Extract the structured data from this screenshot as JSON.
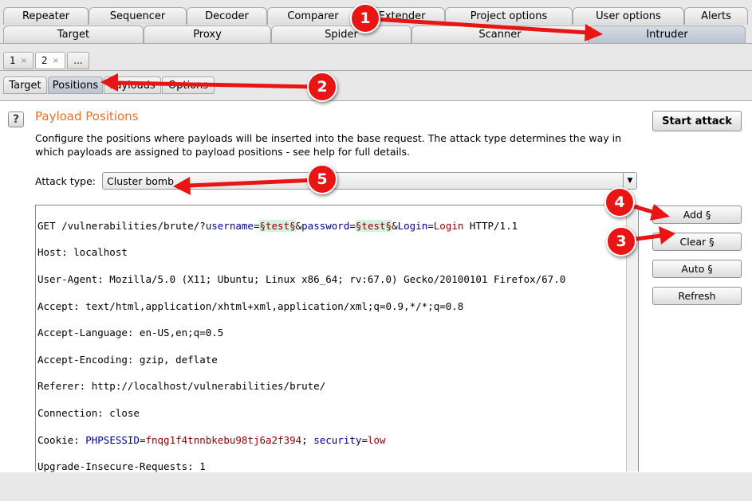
{
  "top_tabs_row1": [
    "Repeater",
    "Sequencer",
    "Decoder",
    "Comparer",
    "Extender",
    "Project options",
    "User options",
    "Alerts"
  ],
  "top_tabs_row2": [
    "Target",
    "Proxy",
    "Spider",
    "Scanner",
    "Intruder"
  ],
  "selected_top_tab": "Intruder",
  "sub_tabs": [
    {
      "label": "1",
      "close": "×"
    },
    {
      "label": "2",
      "close": "×"
    }
  ],
  "sub_tab_more": "...",
  "inner_tabs": [
    "Target",
    "Positions",
    "Payloads",
    "Options"
  ],
  "panel": {
    "help_icon": "?",
    "title": "Payload Positions",
    "description": "Configure the positions where payloads will be inserted into the base request. The attack type determines the way in which payloads are assigned to payload positions - see help for full details.",
    "attack_type_label": "Attack type:",
    "attack_type_value": "Cluster bomb",
    "start_attack_label": "Start attack",
    "buttons": {
      "add": "Add §",
      "clear": "Clear §",
      "auto": "Auto §",
      "refresh": "Refresh"
    }
  },
  "request": {
    "line1": {
      "a": "GET /vulnerabilities/brute/?",
      "p1": "username",
      "eq1": "=",
      "m1": "§test§",
      "amp1": "&",
      "p2": "password",
      "eq2": "=",
      "m2": "§test§",
      "amp2": "&",
      "p3": "Login",
      "eq3": "=",
      "v3": "Login",
      "z": " HTTP/1.1"
    },
    "host": "Host: localhost",
    "user_agent": "User-Agent: Mozilla/5.0 (X11; Ubuntu; Linux x86_64; rv:67.0) Gecko/20100101 Firefox/67.0",
    "accept": "Accept: text/html,application/xhtml+xml,application/xml;q=0.9,*/*;q=0.8",
    "accept_language": "Accept-Language: en-US,en;q=0.5",
    "accept_encoding": "Accept-Encoding: gzip, deflate",
    "referer": "Referer: http://localhost/vulnerabilities/brute/",
    "connection": "Connection: close",
    "cookie": {
      "prefix": "Cookie: ",
      "n1": "PHPSESSID",
      "eq1": "=",
      "v1": "fnqg1f4tnnbkebu98tj6a2f394",
      "sep": "; ",
      "n2": "security",
      "eq2": "=",
      "v2": "low"
    },
    "upgrade": "Upgrade-Insecure-Requests: 1"
  },
  "annotations": [
    "1",
    "2",
    "3",
    "4",
    "5"
  ],
  "annotation_color": "#e81515"
}
